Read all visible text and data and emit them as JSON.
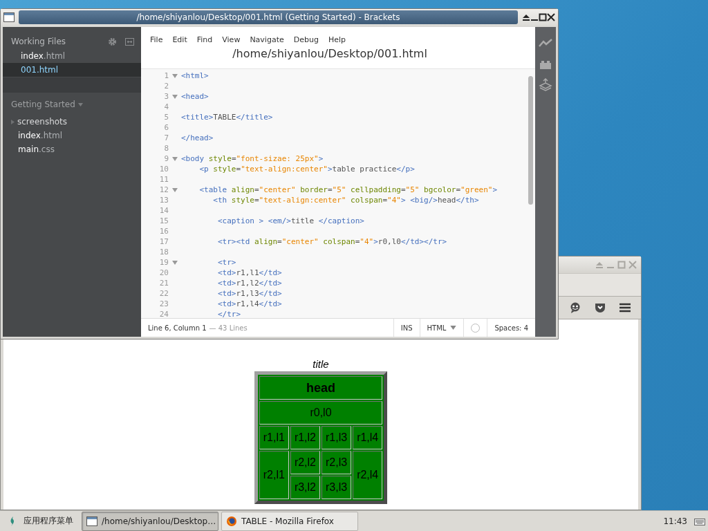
{
  "firefox": {
    "caption": "title",
    "table": {
      "rows": [
        {
          "cells": [
            {
              "text": "head",
              "kind": "header",
              "colspan": 4
            }
          ]
        },
        {
          "cells": [
            {
              "text": "r0,l0",
              "kind": "cell",
              "colspan": 4
            }
          ]
        },
        {
          "cells": [
            {
              "text": "r1,l1",
              "kind": "cell"
            },
            {
              "text": "r1,l2",
              "kind": "cell"
            },
            {
              "text": "r1,l3",
              "kind": "cell"
            },
            {
              "text": "r1,l4",
              "kind": "cell"
            }
          ]
        },
        {
          "cells": [
            {
              "text": "r2,l1",
              "kind": "cell",
              "rowspan": 2
            },
            {
              "text": "r2,l2",
              "kind": "cell"
            },
            {
              "text": "r2,l3",
              "kind": "cell"
            },
            {
              "text": "r2,l4",
              "kind": "cell",
              "rowspan": 2
            }
          ]
        },
        {
          "cells": [
            {
              "text": "r3,l2",
              "kind": "cell"
            },
            {
              "text": "r3,l3",
              "kind": "cell"
            }
          ]
        }
      ]
    }
  },
  "brackets": {
    "window_title": "/home/shiyanlou/Desktop/001.html (Getting Started) - Brackets",
    "sidebar": {
      "working_files_title": "Working Files",
      "working_files": [
        {
          "name": "index",
          "ext": ".html",
          "selected": false
        },
        {
          "name": "001.html",
          "selected": true
        }
      ],
      "project_title": "Getting Started",
      "project_items": [
        {
          "kind": "folder",
          "name": "screenshots"
        },
        {
          "kind": "file",
          "name": "index",
          "ext": ".html"
        },
        {
          "kind": "file",
          "name": "main",
          "ext": ".css"
        }
      ]
    },
    "menu": [
      "File",
      "Edit",
      "Find",
      "View",
      "Navigate",
      "Debug",
      "Help"
    ],
    "path": "/home/shiyanlou/Desktop/001.html",
    "lines": [
      {
        "num": "1",
        "fold": true,
        "tokens": [
          {
            "kind": "tag",
            "text": "<html>"
          }
        ]
      },
      {
        "num": "2",
        "fold": false
      },
      {
        "num": "3",
        "fold": true,
        "tokens": [
          {
            "kind": "tag",
            "text": "<head>"
          }
        ]
      },
      {
        "num": "4",
        "fold": false
      },
      {
        "num": "5",
        "fold": false,
        "tokens": [
          {
            "kind": "tag",
            "text": "<title>"
          },
          {
            "kind": "plain",
            "text": "TABLE"
          },
          {
            "kind": "tag",
            "text": "</title>"
          }
        ]
      },
      {
        "num": "6",
        "fold": false
      },
      {
        "num": "7",
        "fold": false,
        "tokens": [
          {
            "kind": "tag",
            "text": "</head>"
          }
        ]
      },
      {
        "num": "8",
        "fold": false
      },
      {
        "num": "9",
        "fold": true,
        "tokens": [
          {
            "kind": "tag",
            "text": "<body"
          },
          {
            "kind": "attr",
            "text": " style"
          },
          {
            "kind": "plain",
            "text": "="
          },
          {
            "kind": "str",
            "text": "\"font-sizae: 25px\""
          },
          {
            "kind": "tag",
            "text": ">"
          }
        ]
      },
      {
        "num": "10",
        "fold": false,
        "tokens": [
          {
            "kind": "tag",
            "text": "    <p"
          },
          {
            "kind": "attr",
            "text": " style"
          },
          {
            "kind": "plain",
            "text": "="
          },
          {
            "kind": "str",
            "text": "\"text-align:center\""
          },
          {
            "kind": "tag",
            "text": ">"
          },
          {
            "kind": "plain",
            "text": "table practice"
          },
          {
            "kind": "tag",
            "text": "</p>"
          }
        ]
      },
      {
        "num": "11",
        "fold": false
      },
      {
        "num": "12",
        "fold": true,
        "tokens": [
          {
            "kind": "tag",
            "text": "    <table"
          },
          {
            "kind": "attr",
            "text": " align"
          },
          {
            "kind": "plain",
            "text": "="
          },
          {
            "kind": "str",
            "text": "\"center\""
          },
          {
            "kind": "attr",
            "text": " border"
          },
          {
            "kind": "plain",
            "text": "="
          },
          {
            "kind": "str",
            "text": "\"5\""
          },
          {
            "kind": "attr",
            "text": " cellpadding"
          },
          {
            "kind": "plain",
            "text": "="
          },
          {
            "kind": "str",
            "text": "\"5\""
          },
          {
            "kind": "attr",
            "text": " bgcolor"
          },
          {
            "kind": "plain",
            "text": "="
          },
          {
            "kind": "str",
            "text": "\"green\""
          },
          {
            "kind": "tag",
            "text": ">"
          }
        ]
      },
      {
        "num": "13",
        "fold": false,
        "tokens": [
          {
            "kind": "tag",
            "text": "       <th"
          },
          {
            "kind": "attr",
            "text": " style"
          },
          {
            "kind": "plain",
            "text": "="
          },
          {
            "kind": "str",
            "text": "\"text-align:center\""
          },
          {
            "kind": "attr",
            "text": " colspan"
          },
          {
            "kind": "plain",
            "text": "="
          },
          {
            "kind": "str",
            "text": "\"4\""
          },
          {
            "kind": "tag",
            "text": "> <big/>"
          },
          {
            "kind": "plain",
            "text": "head"
          },
          {
            "kind": "tag",
            "text": "</th>"
          }
        ]
      },
      {
        "num": "14",
        "fold": false
      },
      {
        "num": "15",
        "fold": false,
        "tokens": [
          {
            "kind": "tag",
            "text": "        <caption > <em/>"
          },
          {
            "kind": "plain",
            "text": "title "
          },
          {
            "kind": "tag",
            "text": "</caption>"
          }
        ]
      },
      {
        "num": "16",
        "fold": false
      },
      {
        "num": "17",
        "fold": false,
        "tokens": [
          {
            "kind": "tag",
            "text": "        <tr><td"
          },
          {
            "kind": "attr",
            "text": " align"
          },
          {
            "kind": "plain",
            "text": "="
          },
          {
            "kind": "str",
            "text": "\"center\""
          },
          {
            "kind": "attr",
            "text": " colspan"
          },
          {
            "kind": "plain",
            "text": "="
          },
          {
            "kind": "str",
            "text": "\"4\""
          },
          {
            "kind": "tag",
            "text": ">"
          },
          {
            "kind": "plain",
            "text": "r0,l0"
          },
          {
            "kind": "tag",
            "text": "</td></tr>"
          }
        ]
      },
      {
        "num": "18",
        "fold": false
      },
      {
        "num": "19",
        "fold": true,
        "tokens": [
          {
            "kind": "tag",
            "text": "        <tr>"
          }
        ]
      },
      {
        "num": "20",
        "fold": false,
        "tokens": [
          {
            "kind": "tag",
            "text": "        <td>"
          },
          {
            "kind": "plain",
            "text": "r1,l1"
          },
          {
            "kind": "tag",
            "text": "</td>"
          }
        ]
      },
      {
        "num": "21",
        "fold": false,
        "tokens": [
          {
            "kind": "tag",
            "text": "        <td>"
          },
          {
            "kind": "plain",
            "text": "r1,l2"
          },
          {
            "kind": "tag",
            "text": "</td>"
          }
        ]
      },
      {
        "num": "22",
        "fold": false,
        "tokens": [
          {
            "kind": "tag",
            "text": "        <td>"
          },
          {
            "kind": "plain",
            "text": "r1,l3"
          },
          {
            "kind": "tag",
            "text": "</td>"
          }
        ]
      },
      {
        "num": "23",
        "fold": false,
        "tokens": [
          {
            "kind": "tag",
            "text": "        <td>"
          },
          {
            "kind": "plain",
            "text": "r1,l4"
          },
          {
            "kind": "tag",
            "text": "</td>"
          }
        ]
      },
      {
        "num": "24",
        "fold": false,
        "tokens": [
          {
            "kind": "tag",
            "text": "        </tr>"
          }
        ]
      }
    ],
    "status": {
      "cursor": "Line 6, Column 1",
      "line_count": "— 43 Lines",
      "mode": "INS",
      "language": "HTML",
      "spaces": "Spaces: 4"
    }
  },
  "taskbar": {
    "start": "应用程序菜单",
    "tasks": [
      {
        "label": "/home/shiyanlou/Desktop…",
        "kind": "window",
        "selected": true
      },
      {
        "label": "TABLE - Mozilla Firefox",
        "kind": "firefox",
        "selected": false
      }
    ],
    "clock": "11:43"
  }
}
